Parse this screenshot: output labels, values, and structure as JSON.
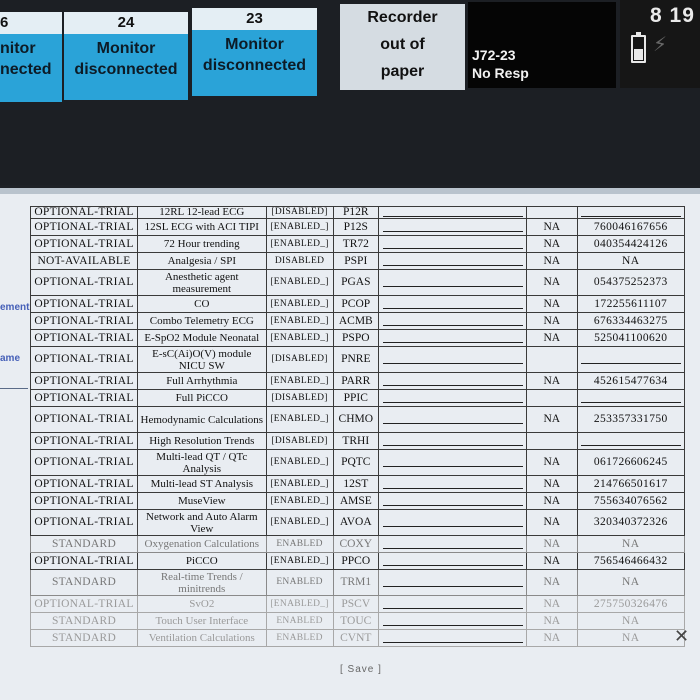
{
  "header": {
    "tiles": [
      {
        "bed": "6",
        "line1": "nitor",
        "line2": "nected"
      },
      {
        "bed": "24",
        "line1": "Monitor",
        "line2": "disconnected"
      },
      {
        "bed": "23",
        "line1": "Monitor",
        "line2": "disconnected"
      }
    ],
    "recorder": {
      "line1": "Recorder",
      "line2": "out of",
      "line3": "paper"
    },
    "resp": {
      "line1": "J72-23",
      "line2": "No Resp"
    },
    "time": "8 19",
    "battery_icon": "battery-icon",
    "plug_icon": "plug-icon"
  },
  "side": {
    "label1": "ement",
    "label2": "ame"
  },
  "rows": [
    {
      "status": "OPTIONAL-TRIAL",
      "name": "12RL 12-lead ECG",
      "state": "[DISABLED]",
      "code": "P12R",
      "na": "",
      "key": ""
    },
    {
      "status": "OPTIONAL-TRIAL",
      "name": "12SL ECG with ACI TIPI",
      "state": "[ENABLED_]",
      "code": "P12S",
      "na": "NA",
      "key": "760046167656"
    },
    {
      "status": "OPTIONAL-TRIAL",
      "name": "72 Hour trending",
      "state": "[ENABLED_]",
      "code": "TR72",
      "na": "NA",
      "key": "040354424126"
    },
    {
      "status": "NOT-AVAILABLE",
      "name": "Analgesia / SPI",
      "state": "DISABLED",
      "code": "PSPI",
      "na": "NA",
      "key": "NA"
    },
    {
      "status": "OPTIONAL-TRIAL",
      "name": "Anesthetic agent measurement",
      "state": "[ENABLED_]",
      "code": "PGAS",
      "na": "NA",
      "key": "054375252373"
    },
    {
      "status": "OPTIONAL-TRIAL",
      "name": "CO",
      "state": "[ENABLED_]",
      "code": "PCOP",
      "na": "NA",
      "key": "172255611107"
    },
    {
      "status": "OPTIONAL-TRIAL",
      "name": "Combo Telemetry ECG",
      "state": "[ENABLED_]",
      "code": "ACMB",
      "na": "NA",
      "key": "676334463275"
    },
    {
      "status": "OPTIONAL-TRIAL",
      "name": "E-SpO2 Module Neonatal",
      "state": "[ENABLED_]",
      "code": "PSPO",
      "na": "NA",
      "key": "525041100620"
    },
    {
      "status": "OPTIONAL-TRIAL",
      "name": "E-sC(Ai)O(V) module NICU SW",
      "state": "[DISABLED]",
      "code": "PNRE",
      "na": "",
      "key": ""
    },
    {
      "status": "OPTIONAL-TRIAL",
      "name": "Full Arrhythmia",
      "state": "[ENABLED_]",
      "code": "PARR",
      "na": "NA",
      "key": "452615477634"
    },
    {
      "status": "OPTIONAL-TRIAL",
      "name": "Full PiCCO",
      "state": "[DISABLED]",
      "code": "PPIC",
      "na": "",
      "key": ""
    },
    {
      "status": "OPTIONAL-TRIAL",
      "name": "Hemodynamic Calculations",
      "state": "[ENABLED_]",
      "code": "CHMO",
      "na": "NA",
      "key": "253357331750"
    },
    {
      "status": "OPTIONAL-TRIAL",
      "name": "High Resolution Trends",
      "state": "[DISABLED]",
      "code": "TRHI",
      "na": "",
      "key": ""
    },
    {
      "status": "OPTIONAL-TRIAL",
      "name": "Multi-lead QT / QTc Analysis",
      "state": "[ENABLED_]",
      "code": "PQTC",
      "na": "NA",
      "key": "061726606245"
    },
    {
      "status": "OPTIONAL-TRIAL",
      "name": "Multi-lead ST Analysis",
      "state": "[ENABLED_]",
      "code": "12ST",
      "na": "NA",
      "key": "214766501617"
    },
    {
      "status": "OPTIONAL-TRIAL",
      "name": "MuseView",
      "state": "[ENABLED_]",
      "code": "AMSE",
      "na": "NA",
      "key": "755634076562"
    },
    {
      "status": "OPTIONAL-TRIAL",
      "name": "Network and Auto Alarm View",
      "state": "[ENABLED_]",
      "code": "AVOA",
      "na": "NA",
      "key": "320340372326"
    },
    {
      "status": "STANDARD",
      "name": "Oxygenation Calculations",
      "state": "ENABLED",
      "code": "COXY",
      "na": "NA",
      "key": "NA"
    },
    {
      "status": "OPTIONAL-TRIAL",
      "name": "PiCCO",
      "state": "[ENABLED_]",
      "code": "PPCO",
      "na": "NA",
      "key": "756546466432"
    },
    {
      "status": "STANDARD",
      "name": "Real-time Trends / minitrends",
      "state": "ENABLED",
      "code": "TRM1",
      "na": "NA",
      "key": "NA"
    },
    {
      "status": "OPTIONAL-TRIAL",
      "name": "SvO2",
      "state": "[ENABLED_]",
      "code": "PSCV",
      "na": "NA",
      "key": "275750326476"
    },
    {
      "status": "STANDARD",
      "name": "Touch User Interface",
      "state": "ENABLED",
      "code": "TOUC",
      "na": "NA",
      "key": "NA"
    },
    {
      "status": "STANDARD",
      "name": "Ventilation Calculations",
      "state": "ENABLED",
      "code": "CVNT",
      "na": "NA",
      "key": "NA"
    }
  ],
  "save_label": "[ Save ]",
  "close_icon": "close-icon"
}
